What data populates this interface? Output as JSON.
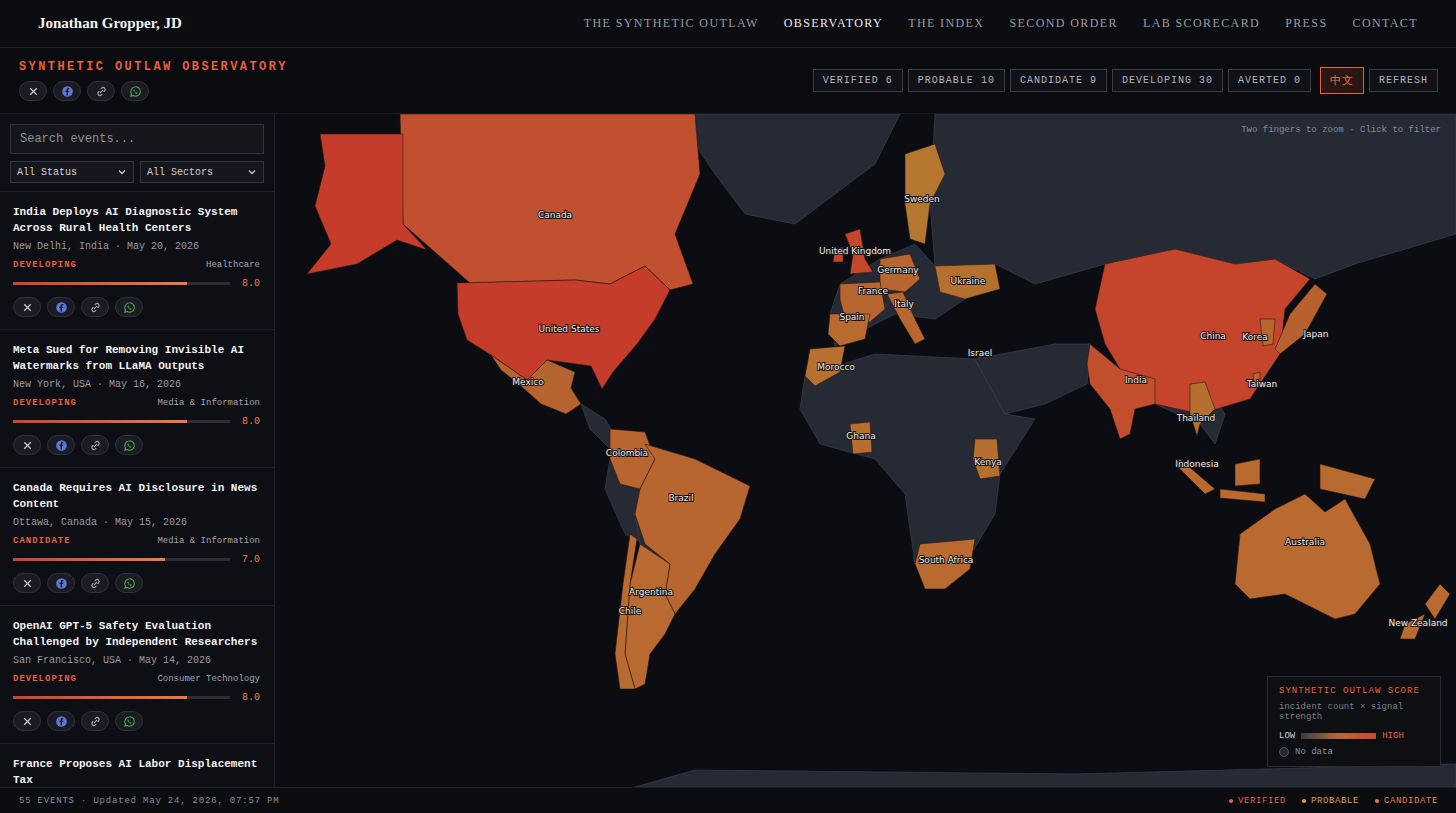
{
  "header": {
    "brand": "Jonathan Gropper, JD",
    "nav": [
      {
        "label": "THE SYNTHETIC OUTLAW",
        "selected": false
      },
      {
        "label": "OBSERVATORY",
        "selected": true
      },
      {
        "label": "THE INDEX",
        "selected": false
      },
      {
        "label": "SECOND ORDER",
        "selected": false
      },
      {
        "label": "LAB SCORECARD",
        "selected": false
      },
      {
        "label": "PRESS",
        "selected": false
      },
      {
        "label": "CONTACT",
        "selected": false
      }
    ]
  },
  "observatory": {
    "title": "SYNTHETIC OUTLAW OBSERVATORY"
  },
  "stats": [
    {
      "label": "VERIFIED",
      "count": "6"
    },
    {
      "label": "PROBABLE",
      "count": "10"
    },
    {
      "label": "CANDIDATE",
      "count": "9"
    },
    {
      "label": "DEVELOPING",
      "count": "30"
    },
    {
      "label": "AVERTED",
      "count": "0"
    }
  ],
  "language_button": "中文",
  "refresh_button": "REFRESH",
  "search": {
    "placeholder": "Search events..."
  },
  "filters": [
    "All Status",
    "All Sectors"
  ],
  "events": [
    {
      "title": "India Deploys AI Diagnostic System Across Rural Health Centers",
      "meta": "New Delhi, India · May 20, 2026",
      "status": "DEVELOPING",
      "sector": "Healthcare",
      "level": 0.8,
      "score": "8.0"
    },
    {
      "title": "Meta Sued for Removing Invisible AI Watermarks from LLaMA Outputs",
      "meta": "New York, USA · May 16, 2026",
      "status": "DEVELOPING",
      "sector": "Media & Information",
      "level": 0.8,
      "score": "8.0"
    },
    {
      "title": "Canada Requires AI Disclosure in News Content",
      "meta": "Ottawa, Canada · May 15, 2026",
      "status": "CANDIDATE",
      "sector": "Media & Information",
      "level": 0.7,
      "score": "7.0"
    },
    {
      "title": "OpenAI GPT-5 Safety Evaluation Challenged by Independent Researchers",
      "meta": "San Francisco, USA · May 14, 2026",
      "status": "DEVELOPING",
      "sector": "Consumer Technology",
      "level": 0.8,
      "score": "8.0"
    },
    {
      "title": "France Proposes AI Labor Displacement Tax"
    }
  ],
  "map": {
    "hint": "Two fingers to zoom · Click to filter",
    "countries": [
      {
        "label": "Canada",
        "color": "#c0502f"
      },
      {
        "label": "United States",
        "color": "#c53c2b"
      },
      {
        "label": "Mexico",
        "color": "#b5632f"
      },
      {
        "label": "Colombia",
        "color": "#b8652f"
      },
      {
        "label": "Brazil",
        "color": "#b8662f"
      },
      {
        "label": "Argentina",
        "color": "#b86a30"
      },
      {
        "label": "Chile",
        "color": "#b86a30"
      },
      {
        "label": "United Kingdom",
        "color": "#c4472c"
      },
      {
        "label": "Sweden",
        "color": "#b5772f"
      },
      {
        "label": "Germany",
        "color": "#b8662f"
      },
      {
        "label": "France",
        "color": "#b8662f"
      },
      {
        "label": "Spain",
        "color": "#b86a30"
      },
      {
        "label": "Italy",
        "color": "#b8662f"
      },
      {
        "label": "Ukraine",
        "color": "#b5702f"
      },
      {
        "label": "Israel",
        "color": "#2a2e3a"
      },
      {
        "label": "Morocco",
        "color": "#b8702f"
      },
      {
        "label": "Ghana",
        "color": "#b5702f"
      },
      {
        "label": "Kenya",
        "color": "#b5702f"
      },
      {
        "label": "South Africa",
        "color": "#b86a30"
      },
      {
        "label": "China",
        "color": "#c4452c"
      },
      {
        "label": "India",
        "color": "#c24f2d"
      },
      {
        "label": "Korea",
        "color": "#b8662f"
      },
      {
        "label": "Japan",
        "color": "#b8602e"
      },
      {
        "label": "Taiwan",
        "color": "#b8662f"
      },
      {
        "label": "Thailand",
        "color": "#b5702f"
      },
      {
        "label": "Indonesia",
        "color": "#b86a30"
      },
      {
        "label": "Australia",
        "color": "#b86a30"
      },
      {
        "label": "New Zealand",
        "color": "#b86a30"
      }
    ],
    "legend": {
      "title": "SYNTHETIC OUTLAW SCORE",
      "subtitle": "incident count × signal strength",
      "low": "LOW",
      "high": "HIGH",
      "no_data": "No data"
    }
  },
  "status_bar": {
    "summary": "55 EVENTS · Updated May 24, 2026, 07:57 PM",
    "legend": [
      {
        "label": "VERIFIED",
        "color": "#e8603c"
      },
      {
        "label": "PROBABLE",
        "color": "#d9a05a"
      },
      {
        "label": "CANDIDATE",
        "color": "#e8803c"
      }
    ]
  }
}
